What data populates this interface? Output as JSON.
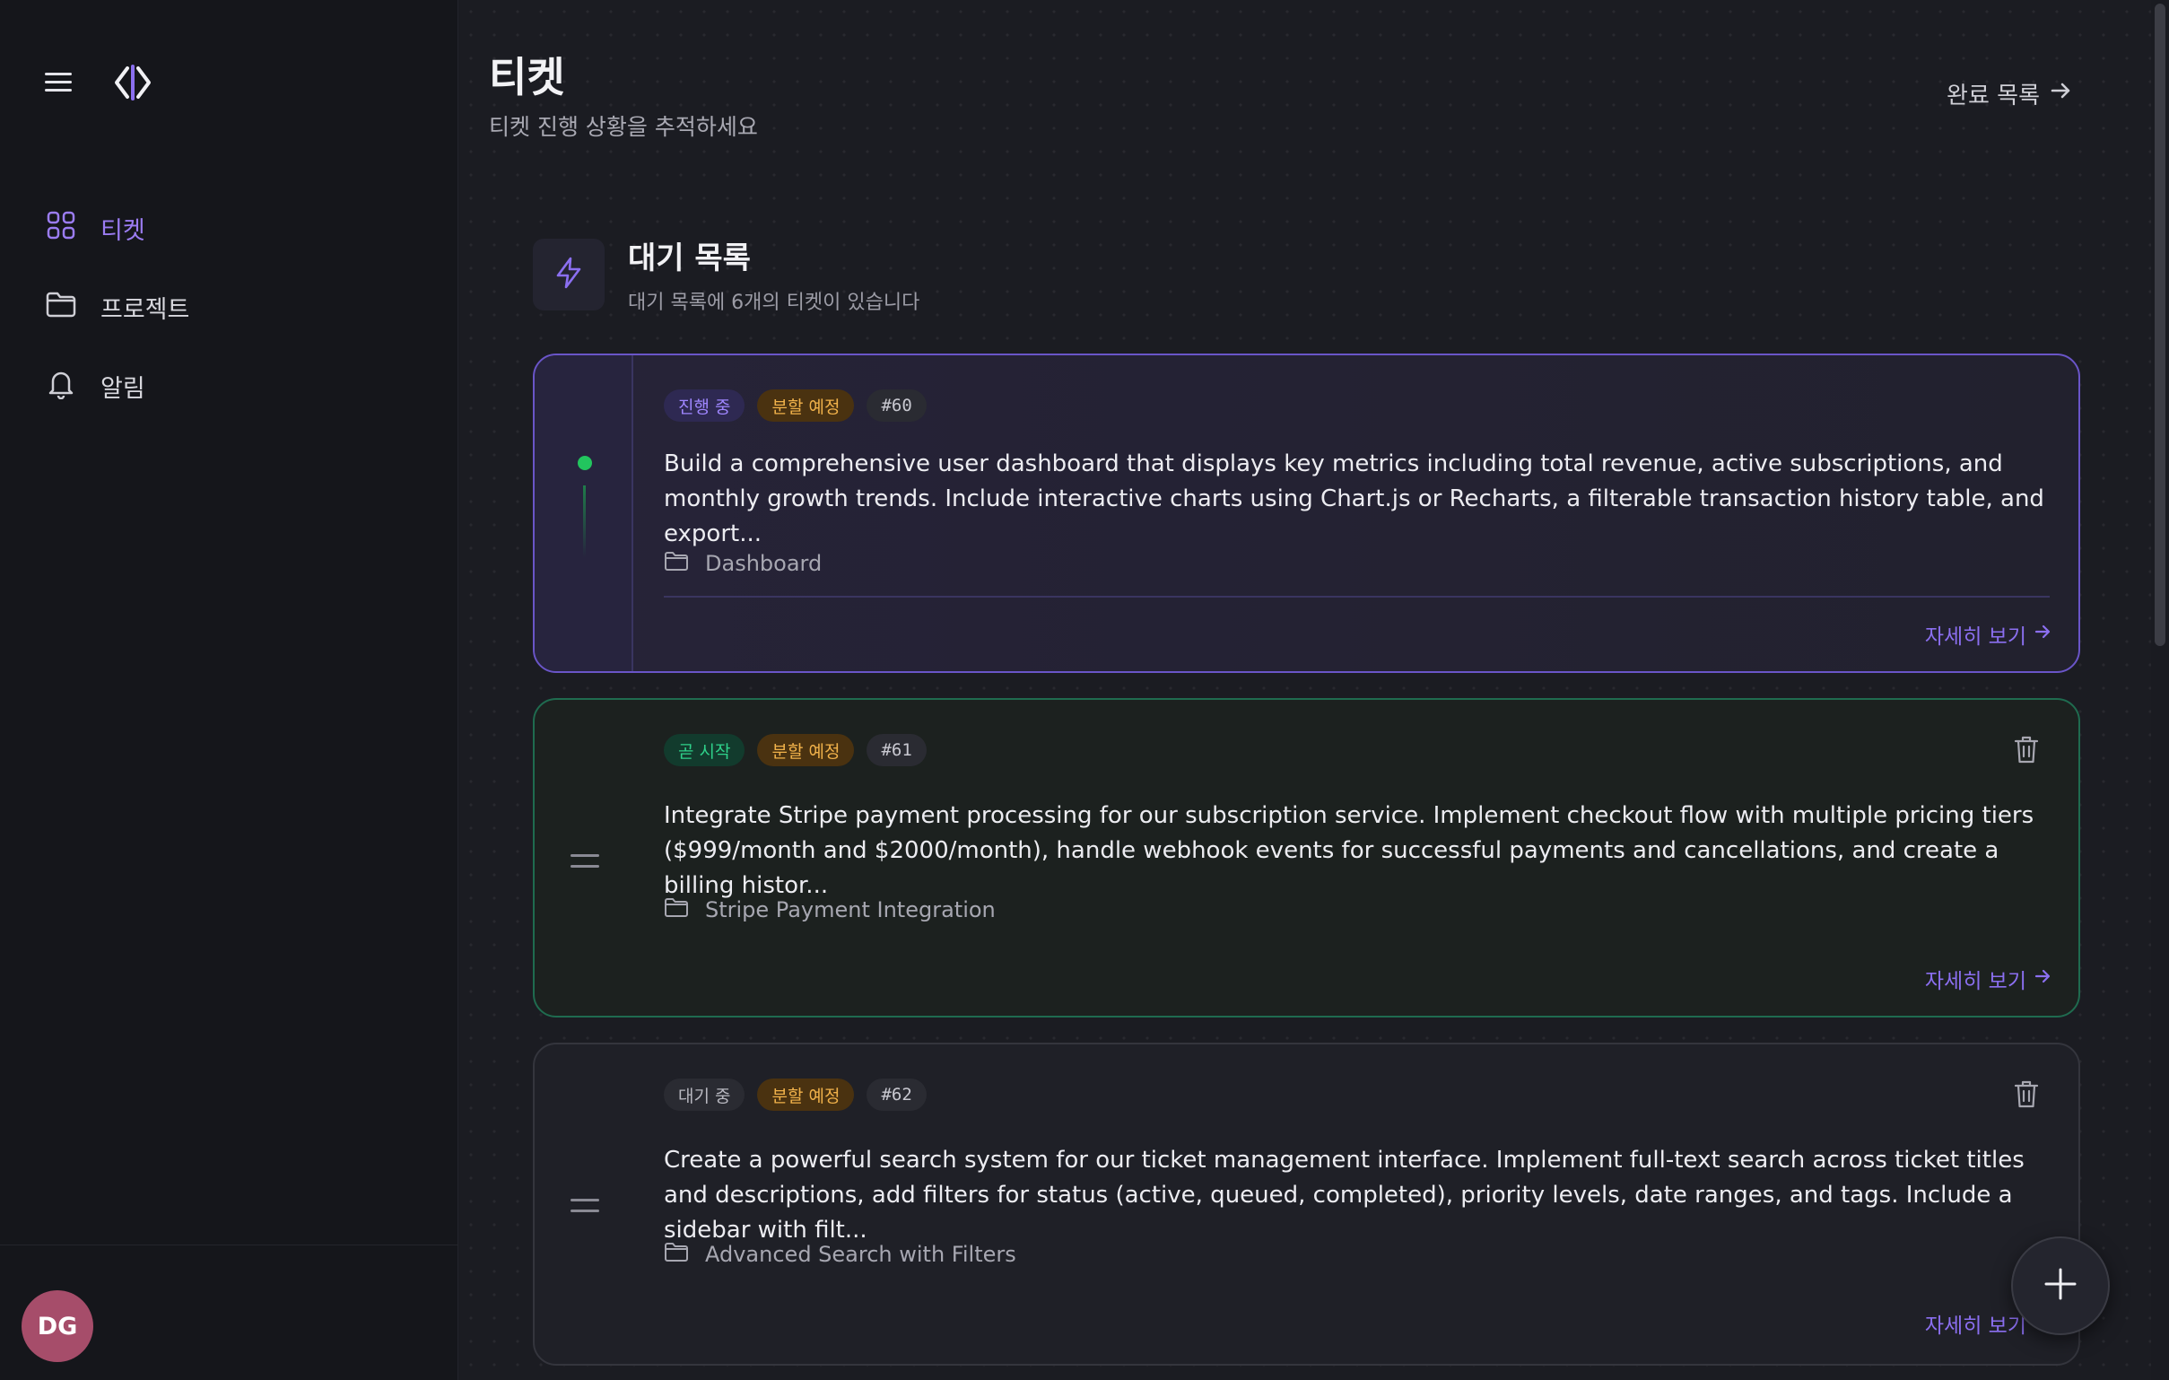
{
  "sidebar": {
    "items": [
      {
        "label": "티켓",
        "icon": "grid-icon",
        "active": true
      },
      {
        "label": "프로젝트",
        "icon": "folder-icon",
        "active": false
      },
      {
        "label": "알림",
        "icon": "bell-icon",
        "active": false
      }
    ],
    "user_initials": "DG"
  },
  "header": {
    "title": "티켓",
    "subtitle": "티켓 진행 상황을 추적하세요",
    "done_link": "완료 목록"
  },
  "section": {
    "title": "대기 목록",
    "subtitle": "대기 목록에 6개의 티켓이 있습니다"
  },
  "tickets": [
    {
      "status": "진행 중",
      "tag": "분할 예정",
      "number": "#60",
      "description": "Build a comprehensive user dashboard that displays key metrics including total revenue, active subscriptions, and monthly growth trends. Include interactive charts using Chart.js or Recharts, a filterable transaction history table, and export...",
      "project": "Dashboard",
      "detail_label": "자세히 보기"
    },
    {
      "status": "곧 시작",
      "tag": "분할 예정",
      "number": "#61",
      "description": "Integrate Stripe payment processing for our subscription service. Implement checkout flow with multiple pricing tiers ($999/month and $2000/month), handle webhook events for successful payments and cancellations, and create a billing histor...",
      "project": "Stripe Payment Integration",
      "detail_label": "자세히 보기"
    },
    {
      "status": "대기 중",
      "tag": "분할 예정",
      "number": "#62",
      "description": "Create a powerful search system for our ticket management interface. Implement full-text search across ticket titles and descriptions, add filters for status (active, queued, completed), priority levels, date ranges, and tags. Include a sidebar with filt...",
      "project": "Advanced Search with Filters",
      "detail_label": "자세히 보기"
    }
  ],
  "colors": {
    "accent": "#8b6ff0",
    "active_status": "#22c55e",
    "warning_tag": "#f0b14a"
  }
}
